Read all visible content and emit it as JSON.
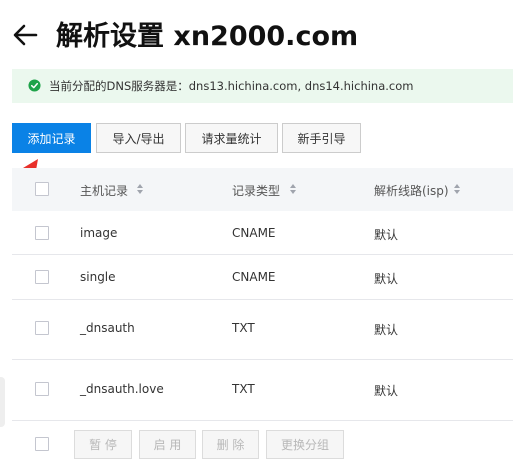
{
  "header": {
    "title": "解析设置 xn2000.com",
    "back_icon": "back-arrow-icon"
  },
  "banner": {
    "icon": "check-circle-icon",
    "icon_color": "#1fa34a",
    "text": "当前分配的DNS服务器是：dns13.hichina.com, dns14.hichina.com"
  },
  "toolbar": {
    "add_record": "添加记录",
    "import_export": "导入/导出",
    "request_stats": "请求量统计",
    "beginner_guide": "新手引导",
    "primary_color": "#0a82e6"
  },
  "annotation": {
    "icon": "red-pointer-arrow-icon",
    "color": "#e8302a"
  },
  "table": {
    "columns": [
      "主机记录",
      "记录类型",
      "解析线路(isp)"
    ],
    "rows": [
      {
        "host": "image",
        "type": "CNAME",
        "line": "默认"
      },
      {
        "host": "single",
        "type": "CNAME",
        "line": "默认"
      },
      {
        "host": "_dnsauth",
        "type": "TXT",
        "line": "默认"
      },
      {
        "host": "_dnsauth.love",
        "type": "TXT",
        "line": "默认"
      }
    ]
  },
  "footer": {
    "pause": "暂 停",
    "enable": "启 用",
    "delete": "删 除",
    "change_group": "更换分组"
  }
}
